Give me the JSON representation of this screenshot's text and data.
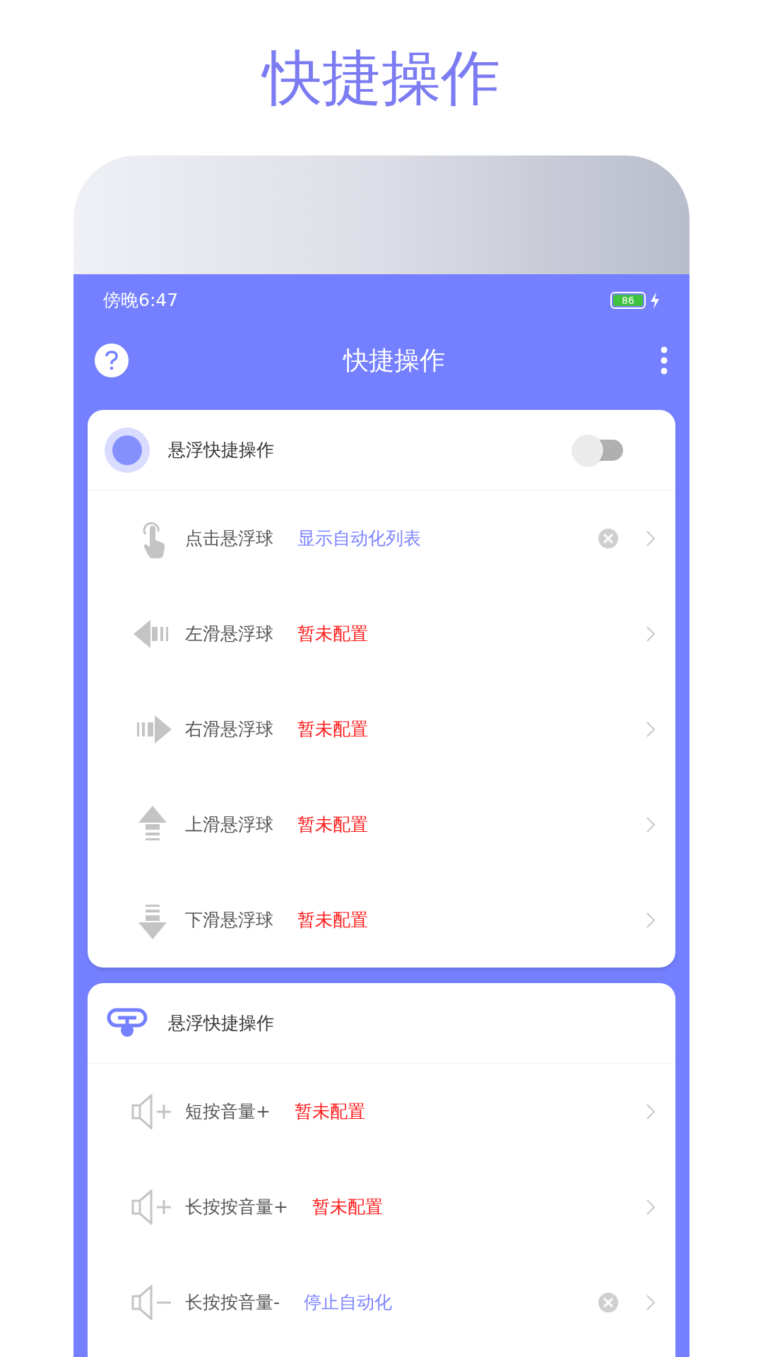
{
  "headline": "快捷操作",
  "status_bar": {
    "time": "傍晚6:47",
    "battery": "86"
  },
  "toolbar": {
    "title": "快捷操作"
  },
  "sections": [
    {
      "kind": "ball",
      "title": "悬浮快捷操作",
      "toggle": {
        "on": false
      },
      "rows": [
        {
          "kind": "tap",
          "label": "点击悬浮球",
          "value": "显示自动化列表",
          "configured": true
        },
        {
          "kind": "swipe-left",
          "label": "左滑悬浮球",
          "value": "暂未配置",
          "configured": false
        },
        {
          "kind": "swipe-right",
          "label": "右滑悬浮球",
          "value": "暂未配置",
          "configured": false
        },
        {
          "kind": "swipe-up",
          "label": "上滑悬浮球",
          "value": "暂未配置",
          "configured": false
        },
        {
          "kind": "swipe-down",
          "label": "下滑悬浮球",
          "value": "暂未配置",
          "configured": false
        }
      ]
    },
    {
      "kind": "key",
      "title": "悬浮快捷操作",
      "rows": [
        {
          "kind": "volume-up",
          "label": "短按音量+",
          "value": "暂未配置",
          "configured": false
        },
        {
          "kind": "volume-up",
          "label": "长按按音量+",
          "value": "暂未配置",
          "configured": false
        },
        {
          "kind": "volume-down",
          "label": "长按按音量-",
          "value": "停止自动化",
          "configured": true
        }
      ]
    }
  ]
}
